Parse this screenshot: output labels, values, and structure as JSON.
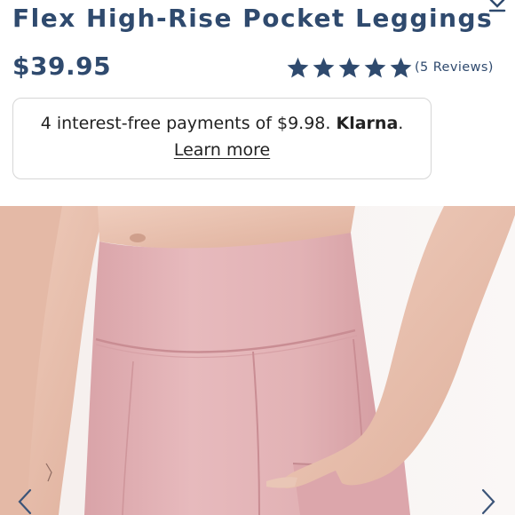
{
  "product": {
    "title": "Flex High-Rise Pocket Leggings",
    "price": "$39.95",
    "rating": 5,
    "reviews_label": "(5 Reviews)"
  },
  "klarna": {
    "text": "4 interest-free payments of $9.98.",
    "brand": "Klarna",
    "brand_suffix": ".",
    "link": "Learn more"
  },
  "colors": {
    "heading": "#2f4a6e",
    "legging": "#e3b4b7",
    "skin": "#e8c2b0"
  },
  "icons": {
    "prev": "chevron-left-icon",
    "next": "chevron-right-icon"
  }
}
